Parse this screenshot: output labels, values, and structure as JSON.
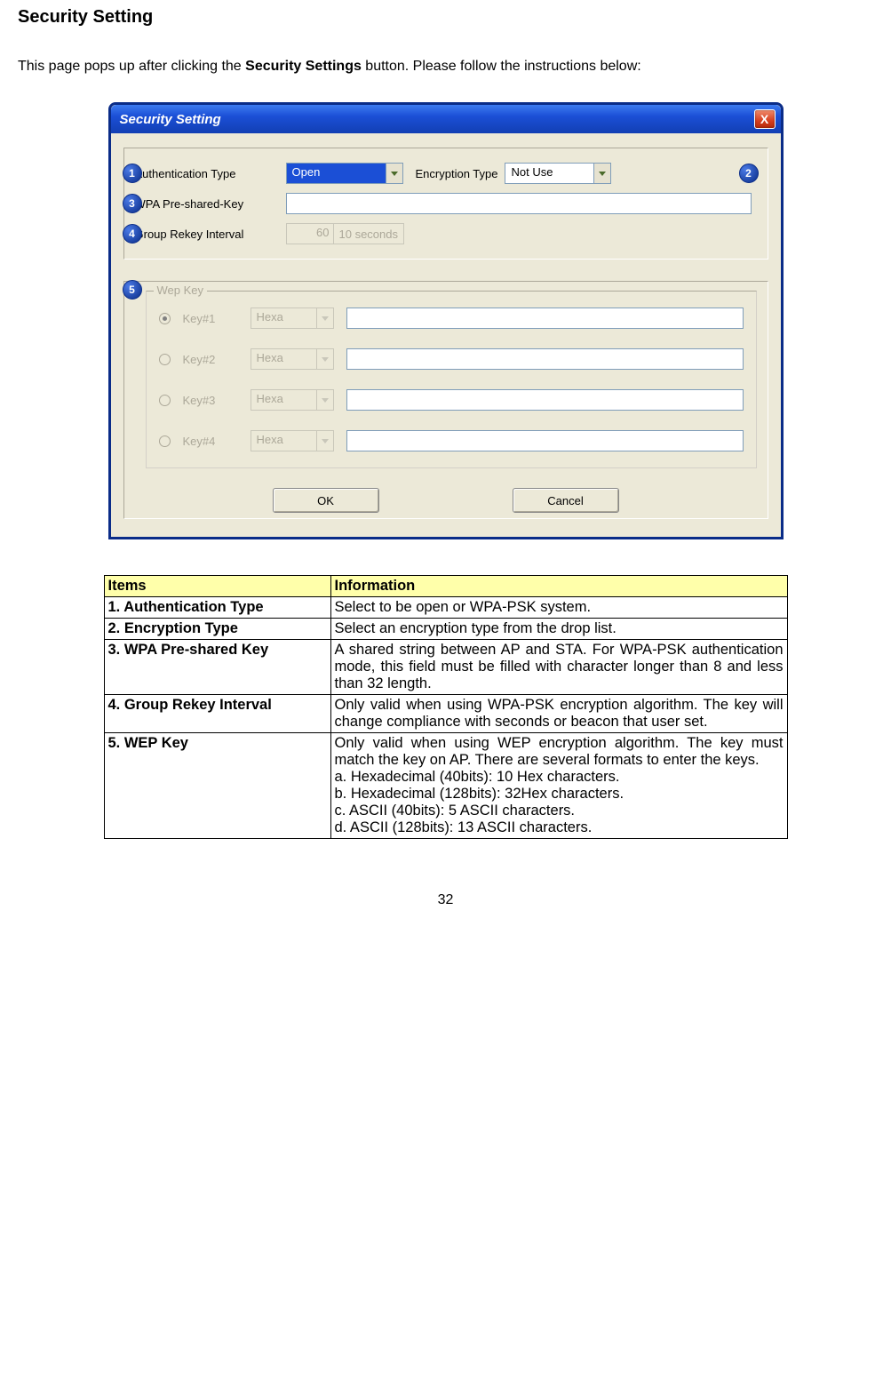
{
  "heading": "Security Setting",
  "intro_before": "This page pops up after clicking the ",
  "intro_bold": "Security Settings",
  "intro_after": " button. Please follow the instructions below:",
  "dialog": {
    "title": "Security Setting",
    "close_icon": "X",
    "badges": {
      "b1": "1",
      "b2": "2",
      "b3": "3",
      "b4": "4",
      "b5": "5"
    },
    "auth_label": "Authentication Type",
    "auth_value": "Open",
    "enc_label": "Encryption Type",
    "enc_value": "Not Use",
    "wpa_label": "WPA Pre-shared-Key",
    "wpa_value": "",
    "rekey_label": "Group Rekey Interval",
    "rekey_value": "60",
    "rekey_unit": "10 seconds",
    "wep_legend": "Wep Key",
    "keys": [
      {
        "label": "Key#1",
        "mode": "Hexa",
        "value": "",
        "checked": true
      },
      {
        "label": "Key#2",
        "mode": "Hexa",
        "value": "",
        "checked": false
      },
      {
        "label": "Key#3",
        "mode": "Hexa",
        "value": "",
        "checked": false
      },
      {
        "label": "Key#4",
        "mode": "Hexa",
        "value": "",
        "checked": false
      }
    ],
    "ok_label": "OK",
    "cancel_label": "Cancel"
  },
  "table": {
    "header_items": "Items",
    "header_info": "Information",
    "rows": [
      {
        "item": "1. Authentication Type",
        "info": "Select to be open or WPA-PSK system."
      },
      {
        "item": "2. Encryption Type",
        "info": "Select an encryption type from the drop list."
      },
      {
        "item": "3. WPA Pre-shared Key",
        "info": "A shared string between AP and STA. For WPA-PSK authentication mode, this field must be filled with character longer than 8 and less than 32 length."
      },
      {
        "item": "4. Group Rekey Interval",
        "info": "Only valid when using WPA-PSK encryption algorithm. The key will change compliance with seconds or beacon that user set."
      },
      {
        "item": "5. WEP Key",
        "info": "Only valid when using WEP encryption algorithm. The key must match the key on AP. There are several formats to enter the keys.\na. Hexadecimal (40bits): 10 Hex characters.\nb. Hexadecimal (128bits): 32Hex characters.\nc. ASCII (40bits): 5 ASCII characters.\nd. ASCII (128bits): 13 ASCII characters."
      }
    ]
  },
  "page_number": "32"
}
